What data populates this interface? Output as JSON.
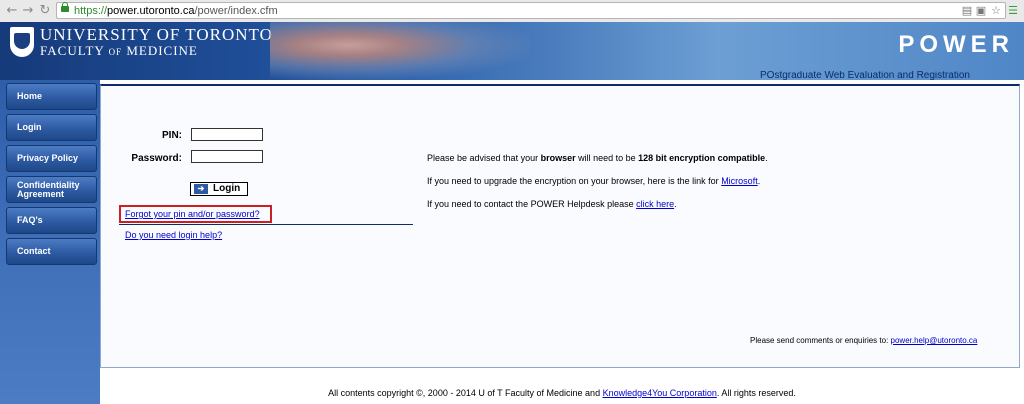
{
  "browser": {
    "url_scheme": "https://",
    "url_host": "power.utoronto.ca",
    "url_path": "/power/index.cfm",
    "back_icon": "←",
    "forward_icon": "→",
    "reload_icon": "↻"
  },
  "banner": {
    "university": "UNIVERSITY OF TORONTO",
    "faculty_a": "FACULTY ",
    "faculty_of": "OF",
    "faculty_b": " MEDICINE",
    "app_name": "POWER",
    "tagline": "POstgraduate Web Evaluation and Registration"
  },
  "sidebar": {
    "items": [
      {
        "label": "Home"
      },
      {
        "label": "Login"
      },
      {
        "label": "Privacy Policy"
      },
      {
        "label": "Confidentiality Agreement"
      },
      {
        "label": "FAQ's"
      },
      {
        "label": "Contact"
      }
    ]
  },
  "login": {
    "pin_label": "PIN:",
    "password_label": "Password:",
    "pin_value": "",
    "password_value": "",
    "button_label": "Login",
    "forgot_link": "Forgot your pin and/or password?",
    "help_link": "Do you need login help?"
  },
  "notice": {
    "line1_pre": "Please be advised that your ",
    "line1_bold1": "browser",
    "line1_mid": " will need to be ",
    "line1_bold2": "128 bit encryption compatible",
    "line1_end": ".",
    "line2_pre": "If you need to upgrade the encryption on your browser, here is the link for ",
    "line2_link": "Microsoft",
    "line2_end": ".",
    "line3_pre": "If you need to contact the POWER Helpdesk please ",
    "line3_link": "click here",
    "line3_end": "."
  },
  "comments": {
    "text": "Please send comments or enquiries to: ",
    "email": "power.help@utoronto.ca"
  },
  "footer": {
    "text_pre": "All contents copyright ©, 2000 - 2014 U of T Faculty of Medicine and ",
    "link": "Knowledge4You Corporation",
    "text_post": ". All rights reserved."
  }
}
